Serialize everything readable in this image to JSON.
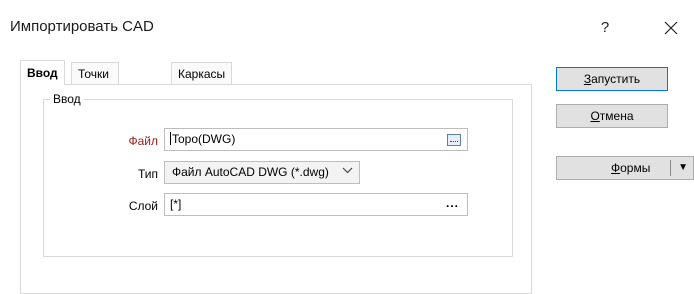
{
  "window": {
    "title": "Импортировать CAD",
    "help_label": "?",
    "close_label": "✕"
  },
  "tabs": [
    {
      "label": "Ввод",
      "active": true
    },
    {
      "label": "Точки и линии",
      "active": false
    },
    {
      "label": "Каркасы",
      "active": false
    }
  ],
  "group": {
    "label": "Ввод"
  },
  "form": {
    "file_label": "Файл",
    "file_value": "Topo(DWG)",
    "type_label": "Тип",
    "type_value": "Файл AutoCAD DWG (*.dwg)",
    "layer_label": "Слой",
    "layer_value": "[*]",
    "browse_ellipsis": "..."
  },
  "buttons": {
    "run_prefix": "",
    "run_accel": "З",
    "run_rest": "апустить",
    "cancel_accel": "О",
    "cancel_rest": "тмена",
    "forms_accel": "Ф",
    "forms_rest": "ормы",
    "forms_arrow": "▼"
  },
  "colors": {
    "required_label": "#9b1b1b",
    "default_button_border": "#0078d7"
  },
  "icons": {
    "browse": "folder-browse-icon",
    "dropdown": "chevron-down-icon",
    "help": "question-icon",
    "close": "close-icon"
  }
}
